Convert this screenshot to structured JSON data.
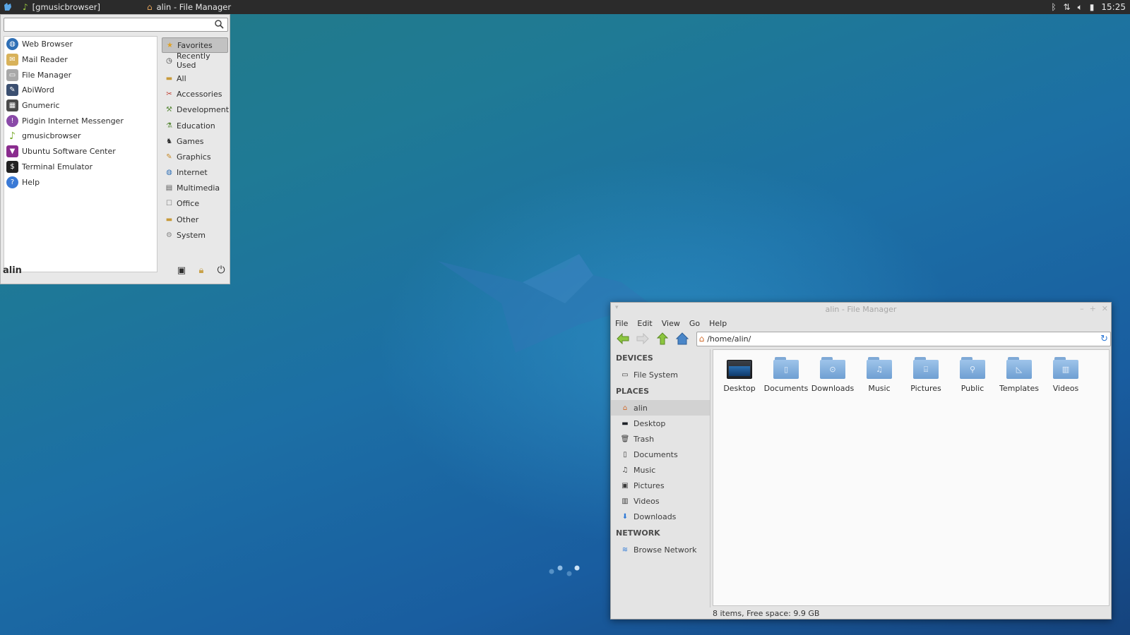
{
  "panel": {
    "tasks": [
      {
        "label": "[gmusicbrowser]",
        "icon": "music-note-icon"
      },
      {
        "label": "alin - File Manager",
        "icon": "home-folder-icon"
      }
    ],
    "clock": "15:25"
  },
  "menu": {
    "search": {
      "value": "",
      "placeholder": ""
    },
    "apps": [
      {
        "label": "Web Browser",
        "icon": "globe-icon",
        "color": "#2f6fb5"
      },
      {
        "label": "Mail Reader",
        "icon": "mail-icon",
        "color": "#c9a24a"
      },
      {
        "label": "File Manager",
        "icon": "file-cabinet-icon",
        "color": "#9a9a9a"
      },
      {
        "label": "AbiWord",
        "icon": "abiword-icon",
        "color": "#3b4f70"
      },
      {
        "label": "Gnumeric",
        "icon": "gnumeric-icon",
        "color": "#4a4a4a"
      },
      {
        "label": "Pidgin Internet Messenger",
        "icon": "pidgin-icon",
        "color": "#8a4aa8"
      },
      {
        "label": "gmusicbrowser",
        "icon": "music-note-icon",
        "color": "#7aab2e"
      },
      {
        "label": "Ubuntu Software Center",
        "icon": "software-center-icon",
        "color": "#8a2c8e"
      },
      {
        "label": "Terminal Emulator",
        "icon": "terminal-icon",
        "color": "#222222"
      },
      {
        "label": "Help",
        "icon": "help-icon",
        "color": "#3a7ad6"
      }
    ],
    "categories": [
      {
        "label": "Favorites",
        "icon": "star-icon",
        "active": true
      },
      {
        "label": "Recently Used",
        "icon": "clock-icon"
      },
      {
        "label": "All",
        "icon": "folder-icon"
      },
      {
        "label": "Accessories",
        "icon": "accessories-icon"
      },
      {
        "label": "Development",
        "icon": "development-icon"
      },
      {
        "label": "Education",
        "icon": "education-icon"
      },
      {
        "label": "Games",
        "icon": "games-icon"
      },
      {
        "label": "Graphics",
        "icon": "graphics-icon"
      },
      {
        "label": "Internet",
        "icon": "globe-icon"
      },
      {
        "label": "Multimedia",
        "icon": "multimedia-icon"
      },
      {
        "label": "Office",
        "icon": "office-icon"
      },
      {
        "label": "Other",
        "icon": "folder-icon"
      },
      {
        "label": "System",
        "icon": "gear-icon"
      }
    ],
    "username": "alin"
  },
  "file_manager": {
    "title": "alin - File Manager",
    "menubar": [
      "File",
      "Edit",
      "View",
      "Go",
      "Help"
    ],
    "location": "/home/alin/",
    "sidebar": {
      "devices_header": "DEVICES",
      "devices": [
        {
          "label": "File System",
          "icon": "drive-icon"
        }
      ],
      "places_header": "PLACES",
      "places": [
        {
          "label": "alin",
          "icon": "home-icon",
          "active": true
        },
        {
          "label": "Desktop",
          "icon": "desktop-icon"
        },
        {
          "label": "Trash",
          "icon": "trash-icon"
        },
        {
          "label": "Documents",
          "icon": "document-icon"
        },
        {
          "label": "Music",
          "icon": "music-note-icon"
        },
        {
          "label": "Pictures",
          "icon": "pictures-icon"
        },
        {
          "label": "Videos",
          "icon": "videos-icon"
        },
        {
          "label": "Downloads",
          "icon": "download-icon"
        }
      ],
      "network_header": "NETWORK",
      "network": [
        {
          "label": "Browse Network",
          "icon": "wifi-icon"
        }
      ]
    },
    "files": [
      {
        "label": "Desktop",
        "icon": "desktop-folder-icon"
      },
      {
        "label": "Documents",
        "icon": "documents-folder-icon"
      },
      {
        "label": "Downloads",
        "icon": "downloads-folder-icon"
      },
      {
        "label": "Music",
        "icon": "music-folder-icon"
      },
      {
        "label": "Pictures",
        "icon": "pictures-folder-icon"
      },
      {
        "label": "Public",
        "icon": "public-folder-icon"
      },
      {
        "label": "Templates",
        "icon": "templates-folder-icon"
      },
      {
        "label": "Videos",
        "icon": "videos-folder-icon"
      }
    ],
    "status": "8 items, Free space: 9.9 GB"
  }
}
